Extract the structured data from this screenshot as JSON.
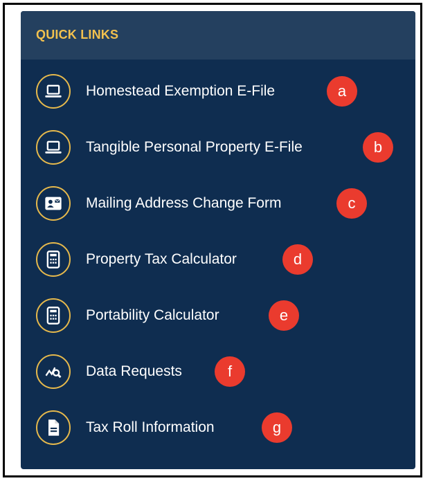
{
  "panel": {
    "title": "QUICK LINKS",
    "links": [
      {
        "label": "Homestead Exemption E-File",
        "badge": "a",
        "icon": "laptop-icon"
      },
      {
        "label": "Tangible Personal Property E-File",
        "badge": "b",
        "icon": "laptop-icon"
      },
      {
        "label": "Mailing Address Change Form",
        "badge": "c",
        "icon": "contact-card-icon"
      },
      {
        "label": "Property Tax Calculator",
        "badge": "d",
        "icon": "calculator-icon"
      },
      {
        "label": "Portability Calculator",
        "badge": "e",
        "icon": "calculator-icon"
      },
      {
        "label": "Data Requests",
        "badge": "f",
        "icon": "chart-search-icon"
      },
      {
        "label": "Tax Roll Information",
        "badge": "g",
        "icon": "document-icon"
      }
    ]
  },
  "colors": {
    "panel_bg": "#0f2d50",
    "header_bg": "#24405f",
    "title": "#f2c14e",
    "icon_ring": "#e6b94c",
    "badge": "#ea3b2e"
  }
}
